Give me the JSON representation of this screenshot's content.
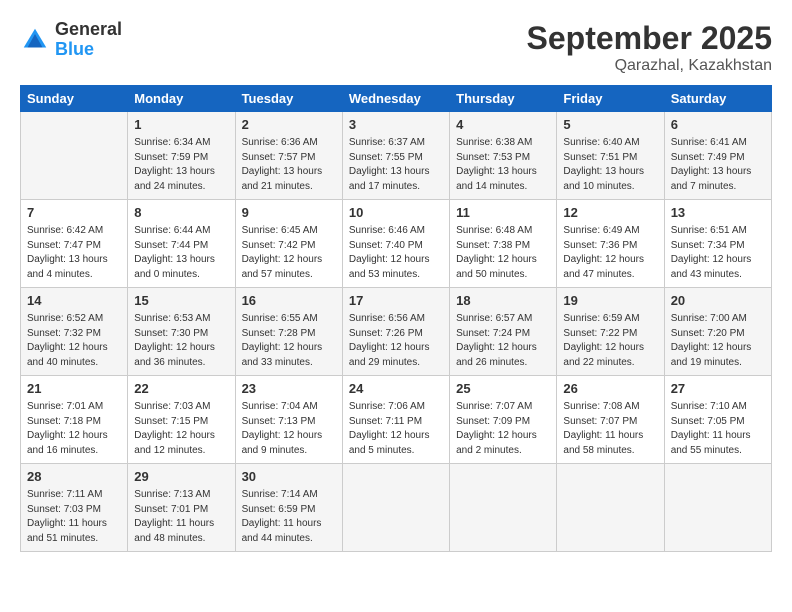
{
  "header": {
    "logo": {
      "general": "General",
      "blue": "Blue"
    },
    "title": "September 2025",
    "location": "Qarazhal, Kazakhstan"
  },
  "weekdays": [
    "Sunday",
    "Monday",
    "Tuesday",
    "Wednesday",
    "Thursday",
    "Friday",
    "Saturday"
  ],
  "weeks": [
    [
      {
        "day": "",
        "sunrise": "",
        "sunset": "",
        "daylight": ""
      },
      {
        "day": "1",
        "sunrise": "Sunrise: 6:34 AM",
        "sunset": "Sunset: 7:59 PM",
        "daylight": "Daylight: 13 hours and 24 minutes."
      },
      {
        "day": "2",
        "sunrise": "Sunrise: 6:36 AM",
        "sunset": "Sunset: 7:57 PM",
        "daylight": "Daylight: 13 hours and 21 minutes."
      },
      {
        "day": "3",
        "sunrise": "Sunrise: 6:37 AM",
        "sunset": "Sunset: 7:55 PM",
        "daylight": "Daylight: 13 hours and 17 minutes."
      },
      {
        "day": "4",
        "sunrise": "Sunrise: 6:38 AM",
        "sunset": "Sunset: 7:53 PM",
        "daylight": "Daylight: 13 hours and 14 minutes."
      },
      {
        "day": "5",
        "sunrise": "Sunrise: 6:40 AM",
        "sunset": "Sunset: 7:51 PM",
        "daylight": "Daylight: 13 hours and 10 minutes."
      },
      {
        "day": "6",
        "sunrise": "Sunrise: 6:41 AM",
        "sunset": "Sunset: 7:49 PM",
        "daylight": "Daylight: 13 hours and 7 minutes."
      }
    ],
    [
      {
        "day": "7",
        "sunrise": "Sunrise: 6:42 AM",
        "sunset": "Sunset: 7:47 PM",
        "daylight": "Daylight: 13 hours and 4 minutes."
      },
      {
        "day": "8",
        "sunrise": "Sunrise: 6:44 AM",
        "sunset": "Sunset: 7:44 PM",
        "daylight": "Daylight: 13 hours and 0 minutes."
      },
      {
        "day": "9",
        "sunrise": "Sunrise: 6:45 AM",
        "sunset": "Sunset: 7:42 PM",
        "daylight": "Daylight: 12 hours and 57 minutes."
      },
      {
        "day": "10",
        "sunrise": "Sunrise: 6:46 AM",
        "sunset": "Sunset: 7:40 PM",
        "daylight": "Daylight: 12 hours and 53 minutes."
      },
      {
        "day": "11",
        "sunrise": "Sunrise: 6:48 AM",
        "sunset": "Sunset: 7:38 PM",
        "daylight": "Daylight: 12 hours and 50 minutes."
      },
      {
        "day": "12",
        "sunrise": "Sunrise: 6:49 AM",
        "sunset": "Sunset: 7:36 PM",
        "daylight": "Daylight: 12 hours and 47 minutes."
      },
      {
        "day": "13",
        "sunrise": "Sunrise: 6:51 AM",
        "sunset": "Sunset: 7:34 PM",
        "daylight": "Daylight: 12 hours and 43 minutes."
      }
    ],
    [
      {
        "day": "14",
        "sunrise": "Sunrise: 6:52 AM",
        "sunset": "Sunset: 7:32 PM",
        "daylight": "Daylight: 12 hours and 40 minutes."
      },
      {
        "day": "15",
        "sunrise": "Sunrise: 6:53 AM",
        "sunset": "Sunset: 7:30 PM",
        "daylight": "Daylight: 12 hours and 36 minutes."
      },
      {
        "day": "16",
        "sunrise": "Sunrise: 6:55 AM",
        "sunset": "Sunset: 7:28 PM",
        "daylight": "Daylight: 12 hours and 33 minutes."
      },
      {
        "day": "17",
        "sunrise": "Sunrise: 6:56 AM",
        "sunset": "Sunset: 7:26 PM",
        "daylight": "Daylight: 12 hours and 29 minutes."
      },
      {
        "day": "18",
        "sunrise": "Sunrise: 6:57 AM",
        "sunset": "Sunset: 7:24 PM",
        "daylight": "Daylight: 12 hours and 26 minutes."
      },
      {
        "day": "19",
        "sunrise": "Sunrise: 6:59 AM",
        "sunset": "Sunset: 7:22 PM",
        "daylight": "Daylight: 12 hours and 22 minutes."
      },
      {
        "day": "20",
        "sunrise": "Sunrise: 7:00 AM",
        "sunset": "Sunset: 7:20 PM",
        "daylight": "Daylight: 12 hours and 19 minutes."
      }
    ],
    [
      {
        "day": "21",
        "sunrise": "Sunrise: 7:01 AM",
        "sunset": "Sunset: 7:18 PM",
        "daylight": "Daylight: 12 hours and 16 minutes."
      },
      {
        "day": "22",
        "sunrise": "Sunrise: 7:03 AM",
        "sunset": "Sunset: 7:15 PM",
        "daylight": "Daylight: 12 hours and 12 minutes."
      },
      {
        "day": "23",
        "sunrise": "Sunrise: 7:04 AM",
        "sunset": "Sunset: 7:13 PM",
        "daylight": "Daylight: 12 hours and 9 minutes."
      },
      {
        "day": "24",
        "sunrise": "Sunrise: 7:06 AM",
        "sunset": "Sunset: 7:11 PM",
        "daylight": "Daylight: 12 hours and 5 minutes."
      },
      {
        "day": "25",
        "sunrise": "Sunrise: 7:07 AM",
        "sunset": "Sunset: 7:09 PM",
        "daylight": "Daylight: 12 hours and 2 minutes."
      },
      {
        "day": "26",
        "sunrise": "Sunrise: 7:08 AM",
        "sunset": "Sunset: 7:07 PM",
        "daylight": "Daylight: 11 hours and 58 minutes."
      },
      {
        "day": "27",
        "sunrise": "Sunrise: 7:10 AM",
        "sunset": "Sunset: 7:05 PM",
        "daylight": "Daylight: 11 hours and 55 minutes."
      }
    ],
    [
      {
        "day": "28",
        "sunrise": "Sunrise: 7:11 AM",
        "sunset": "Sunset: 7:03 PM",
        "daylight": "Daylight: 11 hours and 51 minutes."
      },
      {
        "day": "29",
        "sunrise": "Sunrise: 7:13 AM",
        "sunset": "Sunset: 7:01 PM",
        "daylight": "Daylight: 11 hours and 48 minutes."
      },
      {
        "day": "30",
        "sunrise": "Sunrise: 7:14 AM",
        "sunset": "Sunset: 6:59 PM",
        "daylight": "Daylight: 11 hours and 44 minutes."
      },
      {
        "day": "",
        "sunrise": "",
        "sunset": "",
        "daylight": ""
      },
      {
        "day": "",
        "sunrise": "",
        "sunset": "",
        "daylight": ""
      },
      {
        "day": "",
        "sunrise": "",
        "sunset": "",
        "daylight": ""
      },
      {
        "day": "",
        "sunrise": "",
        "sunset": "",
        "daylight": ""
      }
    ]
  ]
}
